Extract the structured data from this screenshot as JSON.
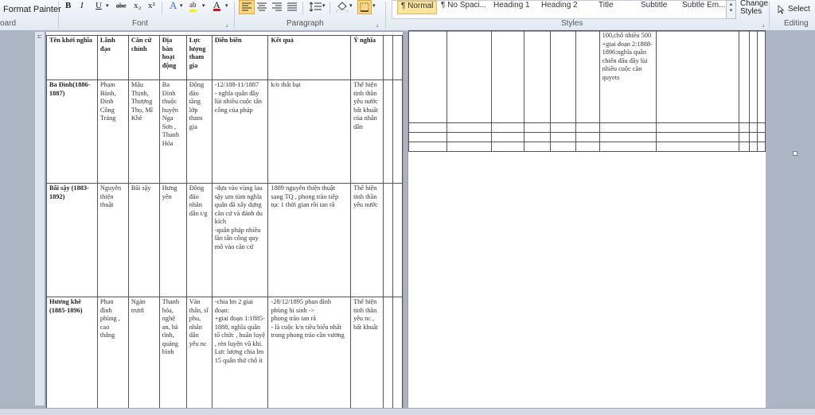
{
  "ribbon": {
    "clipboard": {
      "format_painter": "Format Painter",
      "label": "oard"
    },
    "font": {
      "label": "Font",
      "bold": "B",
      "italic": "I",
      "underline": "U",
      "strike": "abc",
      "subscript": "x₂",
      "superscript": "x²",
      "text_effects": "A",
      "highlight": "ab",
      "font_color": "A"
    },
    "paragraph": {
      "label": "Paragraph"
    },
    "styles": {
      "label": "Styles",
      "items": [
        "¶ Normal",
        "¶ No Spaci...",
        "Heading 1",
        "Heading 2",
        "Title",
        "Subtitle",
        "Subtle Em..."
      ],
      "change_styles": [
        "Change",
        "Styles"
      ]
    },
    "editing": {
      "label": "Editing",
      "select": "Select"
    }
  },
  "table_left": {
    "headers": [
      "Tên khởi nghĩa",
      "Lãnh đạo",
      "Căn cứ chính",
      "Địa bàn hoạt động",
      "Lực lượng tham gia",
      "Diễn biến",
      "Kết quả",
      "Ý nghĩa",
      "",
      ""
    ],
    "rows": [
      [
        "Ba Đình(1886-1887)",
        "Phạm Bành, Đinh Công Tráng",
        "Mậu Thịnh, Thượng Thọ, Mĩ Khê",
        "Ba Đình thuộc huyện Nga Sơn , Thanh Hóa",
        "Động đảo tầng lớp tham gia",
        "-12/188-11/1887\n- nghĩa quân đầy lùi nhiều cuộc tấn công của pháp",
        "k/n thất bại",
        "Thể hiện tinh thần yêu nước bất khuất của nhân dân",
        "",
        ""
      ],
      [
        "Bãi sậy (1883-1892)",
        "Nguyễn thiện thuật",
        "Bãi sậy",
        "Hưng yên",
        "Đông đảo nhân dân t/g",
        "-dựa vào vùng lau sậy um tùm nghĩa quân đã xây dựng căn cứ và đánh du kích\n-quân pháp nhiều lần tấn công quy mô vào căn cứ",
        "1889 nguyễn thiện thuật sang TQ , phong trào tiếp tục 1 thời gian rồi tan rã",
        "Thể hiện tinh thần yêu nước",
        "",
        ""
      ],
      [
        "Hương khê (1885-1896)",
        "Phan đình phùng , cao thắng",
        "Ngàn trươi",
        "Thanh hóa, nghệ an, hà tĩnh, quảng bình",
        "Văn thân, sĩ phu, nhân dân yêu nc",
        "-chia lm 2 giai đoạn:\n+giai đoạn 1:1885-1888, nghĩa quân tổ chức , huấn luyệ , rèn luyện vũ khí. Lực lượng chia lm 15 quân thứ chỗ ít",
        "-28/12/1895 phan đình phùng hi sinh ->\nphong trào tan rã\n- là cuộc k/n tiêu biểu nhất trong phong trào cần vương",
        "Thể hiện tinh thần yêu nc , bất khuất",
        "",
        ""
      ]
    ]
  },
  "table_right": {
    "rows": [
      [
        "",
        "",
        "",
        "",
        "",
        "",
        "100,chỗ nhiều 500\n+giai đoạn 2:1888-1896:nghĩa quân chiến đấu đầy lùi nhiều cuộc càn quyets",
        "",
        "",
        "",
        ""
      ],
      [
        "",
        "",
        "",
        "",
        "",
        "",
        "",
        "",
        "",
        "",
        ""
      ],
      [
        "",
        "",
        "",
        "",
        "",
        "",
        "",
        "",
        "",
        "",
        ""
      ],
      [
        "",
        "",
        "",
        "",
        "",
        "",
        "",
        "",
        "",
        "",
        ""
      ]
    ]
  },
  "colors": {
    "ribbon_bg": "#e3e9f2",
    "workspace": "#abb5c3",
    "highlight_style": "#fbe3a0",
    "font_color_bar": "#d11818",
    "highlight_bar": "#f7f000"
  }
}
